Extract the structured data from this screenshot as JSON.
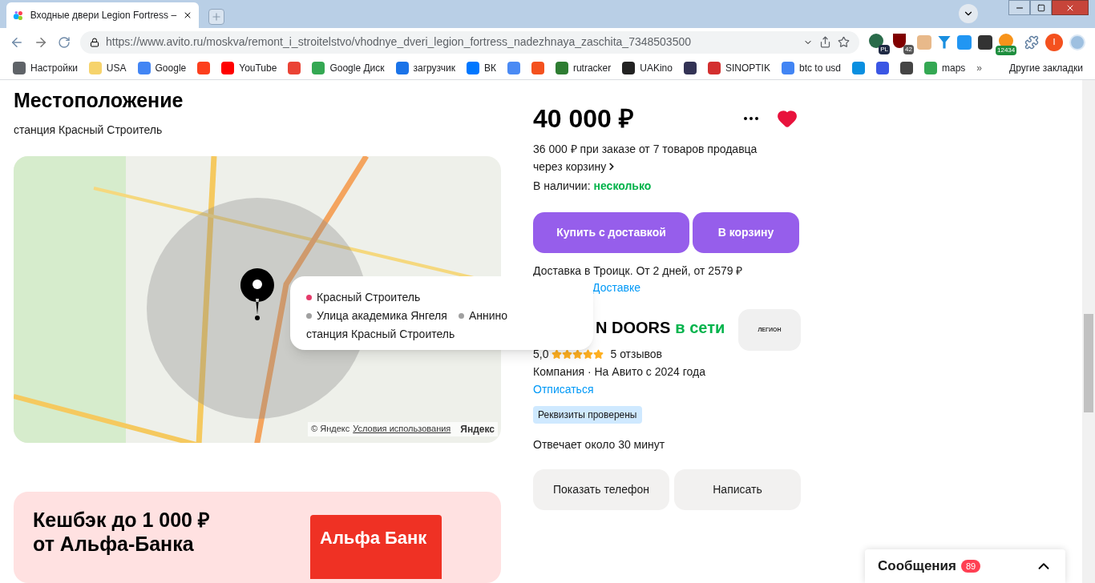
{
  "browser": {
    "tab": {
      "title": "Входные двери Legion Fortress –",
      "selected": true
    },
    "url": "https://www.avito.ru/moskva/remont_i_stroitelstvo/vhodnye_dveri_legion_fortress_nadezhnaya_zaschita_7348503500",
    "extension_badges": [
      "PL",
      "42",
      "12434"
    ],
    "profile_initial": "I",
    "bookmarks": [
      {
        "label": "Настройки",
        "color": "#5f6368"
      },
      {
        "label": "USA",
        "color": "#f6d36b"
      },
      {
        "label": "Google",
        "color": "#4285f4"
      },
      {
        "color": "#fc3f1d"
      },
      {
        "label": "YouTube",
        "color": "#ff0000"
      },
      {
        "color": "#ea4335"
      },
      {
        "label": "Google Диск",
        "color": "#34a853"
      },
      {
        "label": "загрузчик",
        "color": "#1a73e8"
      },
      {
        "label": "ВК",
        "color": "#0077ff"
      },
      {
        "color": "#4a8af4"
      },
      {
        "color": "#f4511e"
      },
      {
        "label": "rutracker",
        "color": "#2e7d32"
      },
      {
        "label": "UAKino",
        "color": "#222222"
      },
      {
        "color": "#333355"
      },
      {
        "label": "SINOPTIK",
        "color": "#d32f2f"
      },
      {
        "label": "btc to usd",
        "color": "#4285f4"
      },
      {
        "color": "#0a8fe0"
      },
      {
        "color": "#3a56e4"
      },
      {
        "color": "#444444"
      },
      {
        "label": "maps",
        "color": "#34a853"
      }
    ],
    "more_bookmarks": "»",
    "other_bookmarks": "Другие закладки"
  },
  "location": {
    "title": "Местоположение",
    "station": "станция Красный Строитель",
    "map": {
      "popup": {
        "stations": [
          {
            "name": "Красный Строитель",
            "color": "#e53a6a"
          },
          {
            "name": "Улица академика Янгеля",
            "color": "#a0a0a0"
          },
          {
            "name": "Аннино",
            "color": "#a0a0a0"
          }
        ],
        "address": "станция Красный Строитель"
      },
      "copyright": "© Яндекс",
      "terms_link": "Условия использования",
      "logo": "Яндекс"
    }
  },
  "promo": {
    "title": "Кешбэк до 1 000 ₽",
    "subtitle": "от Альфа-Банка",
    "bank_logo": "Альфа Банк"
  },
  "offer": {
    "price": "40 000 ₽",
    "favorite": true,
    "bulk_price": "36 000 ₽ при заказе от 7 товаров продавца",
    "bulk_link": "через корзину",
    "stock_label": "В наличии:",
    "stock_value": "несколько",
    "buttons": [
      "Купить с доставкой",
      "В корзину"
    ],
    "delivery": "Доставка в Троицк. От 2 дней, от 2579 ₽",
    "delivery_link": "Доставке"
  },
  "seller": {
    "name": "N DOORS",
    "status": "в сети",
    "rating": "5,0",
    "stars": 5,
    "reviews": "5 отзывов",
    "info": "Компания · На Авито с 2024 года",
    "unsubscribe": "Отписаться",
    "verified_badge": "Реквизиты проверены",
    "response_time": "Отвечает около 30 минут",
    "logo_text": "ЛЕГИОН",
    "buttons": [
      "Показать телефон",
      "Написать"
    ]
  },
  "messages": {
    "label": "Сообщения",
    "count": "89"
  }
}
